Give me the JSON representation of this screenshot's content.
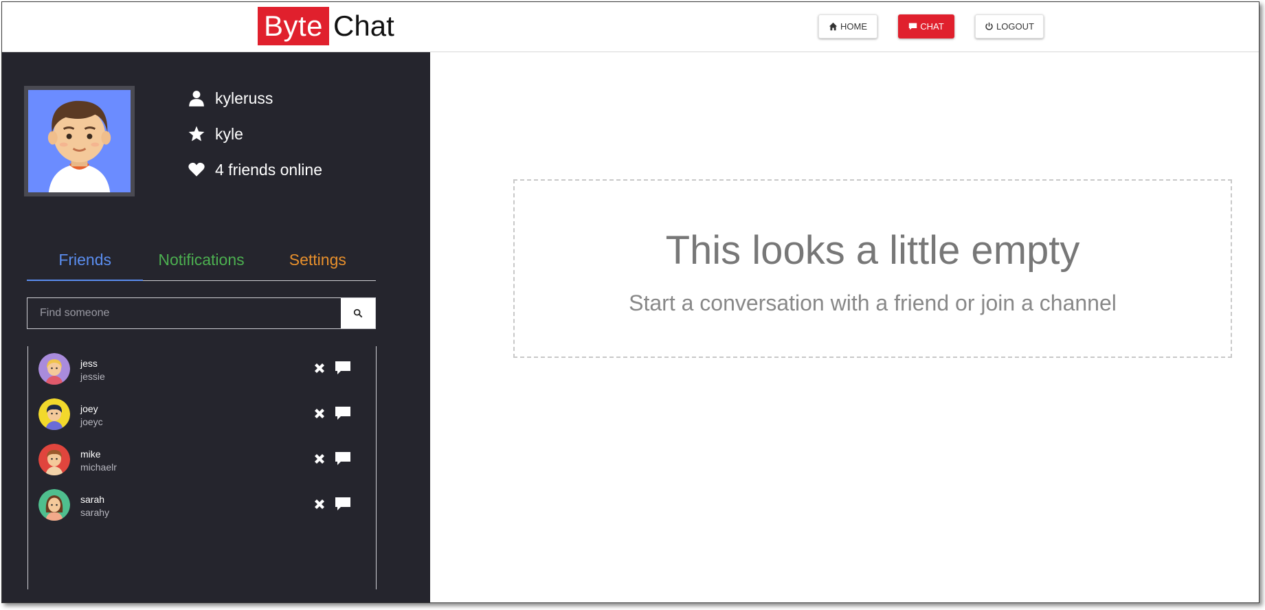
{
  "header": {
    "logo_part1": "Byte",
    "logo_part2": "Chat",
    "nav": [
      {
        "label": "HOME",
        "icon": "home-icon"
      },
      {
        "label": "CHAT",
        "icon": "chat-icon"
      },
      {
        "label": "LOGOUT",
        "icon": "power-icon"
      }
    ]
  },
  "profile": {
    "username": "kyleruss",
    "display_name": "kyle",
    "online_status": "4 friends online"
  },
  "tabs": [
    {
      "label": "Friends",
      "color": "#5b8ef0",
      "active": true
    },
    {
      "label": "Notifications",
      "color": "#4caf50",
      "active": false
    },
    {
      "label": "Settings",
      "color": "#e8902c",
      "active": false
    }
  ],
  "search": {
    "placeholder": "Find someone"
  },
  "friends": [
    {
      "name": "jess",
      "username": "jessie",
      "avatar_color": "#a98bdc"
    },
    {
      "name": "joey",
      "username": "joeyc",
      "avatar_color": "#f2d92c"
    },
    {
      "name": "mike",
      "username": "michaelr",
      "avatar_color": "#e0453d"
    },
    {
      "name": "sarah",
      "username": "sarahy",
      "avatar_color": "#4fbf8e"
    }
  ],
  "empty_state": {
    "title": "This looks a little empty",
    "subtitle": "Start a conversation with a friend or join a channel"
  },
  "colors": {
    "brand_red": "#e0202d",
    "sidebar_bg": "#25252d"
  }
}
